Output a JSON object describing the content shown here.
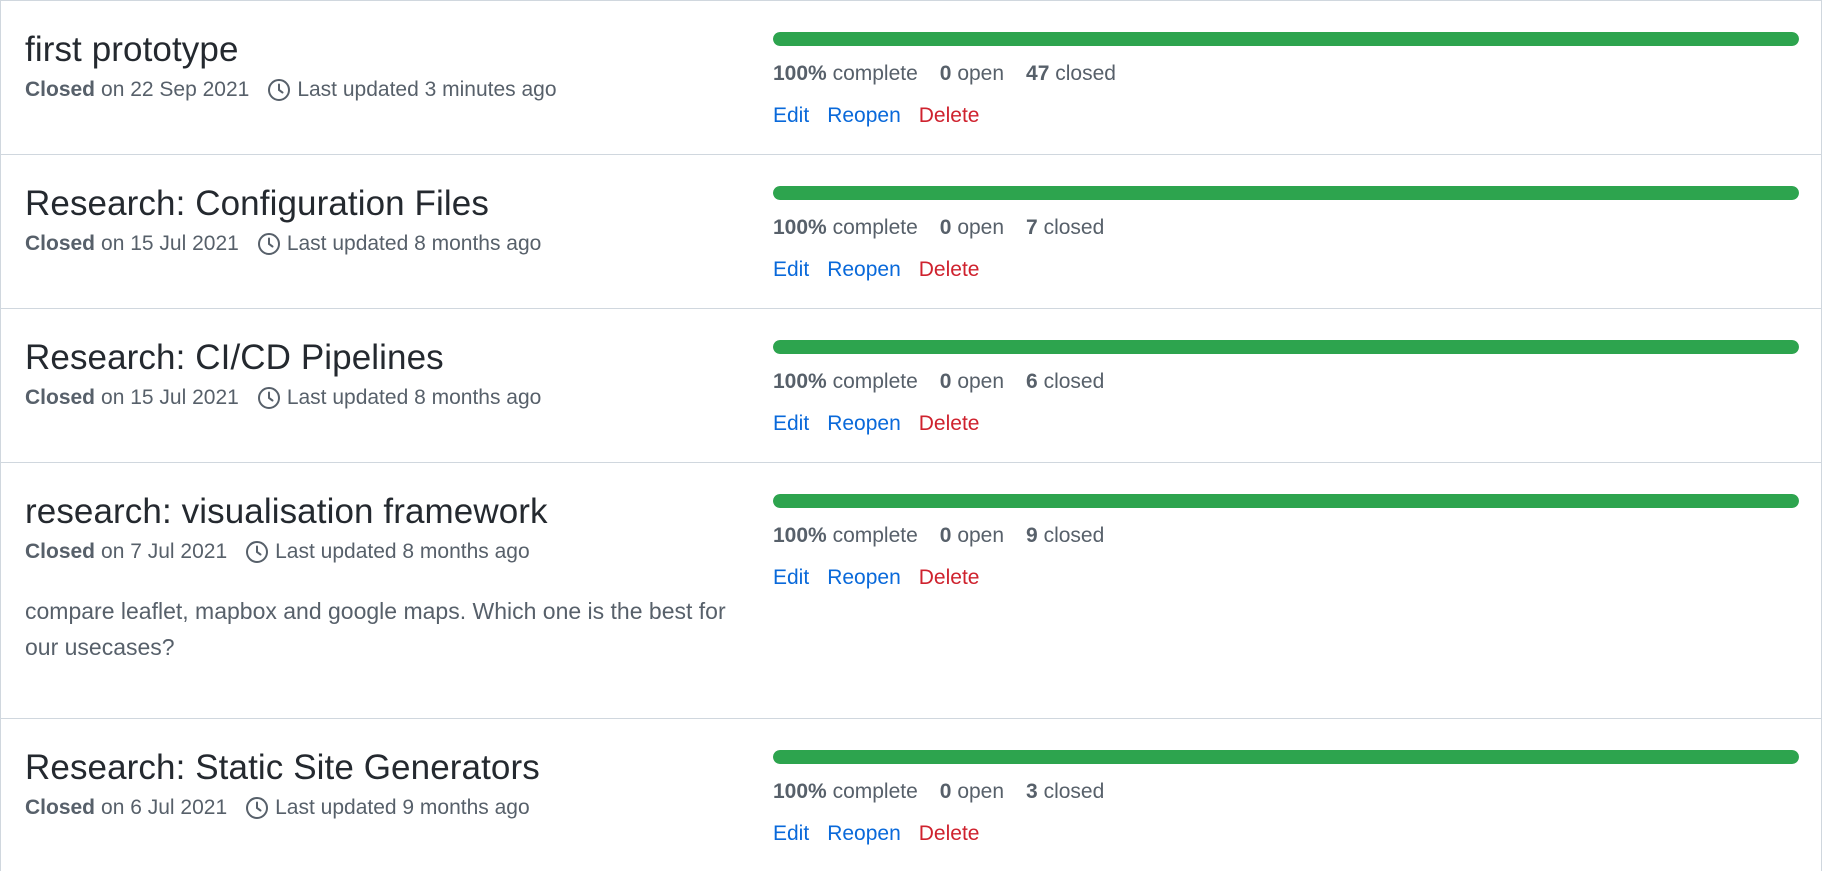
{
  "labels": {
    "closed": "Closed",
    "last_updated_prefix": "Last updated",
    "complete_suffix": "complete",
    "open_suffix": "open",
    "closed_suffix": "closed",
    "edit": "Edit",
    "reopen": "Reopen",
    "delete": "Delete"
  },
  "colors": {
    "progress": "#2da44e",
    "link": "#0969da",
    "danger": "#cf222e"
  },
  "milestones": [
    {
      "title": "first prototype",
      "closed_on": "on 22 Sep 2021",
      "updated": "3 minutes ago",
      "description": "",
      "progress_percent": 100,
      "percent_text": "100%",
      "open": "0",
      "closed": "47"
    },
    {
      "title": "Research: Configuration Files",
      "closed_on": "on 15 Jul 2021",
      "updated": "8 months ago",
      "description": "",
      "progress_percent": 100,
      "percent_text": "100%",
      "open": "0",
      "closed": "7"
    },
    {
      "title": "Research: CI/CD Pipelines",
      "closed_on": "on 15 Jul 2021",
      "updated": "8 months ago",
      "description": "",
      "progress_percent": 100,
      "percent_text": "100%",
      "open": "0",
      "closed": "6"
    },
    {
      "title": "research: visualisation framework",
      "closed_on": "on 7 Jul 2021",
      "updated": "8 months ago",
      "description": "compare leaflet, mapbox and google maps. Which one is the best for our usecases?",
      "progress_percent": 100,
      "percent_text": "100%",
      "open": "0",
      "closed": "9"
    },
    {
      "title": "Research: Static Site Generators",
      "closed_on": "on 6 Jul 2021",
      "updated": "9 months ago",
      "description": "",
      "progress_percent": 100,
      "percent_text": "100%",
      "open": "0",
      "closed": "3"
    }
  ]
}
